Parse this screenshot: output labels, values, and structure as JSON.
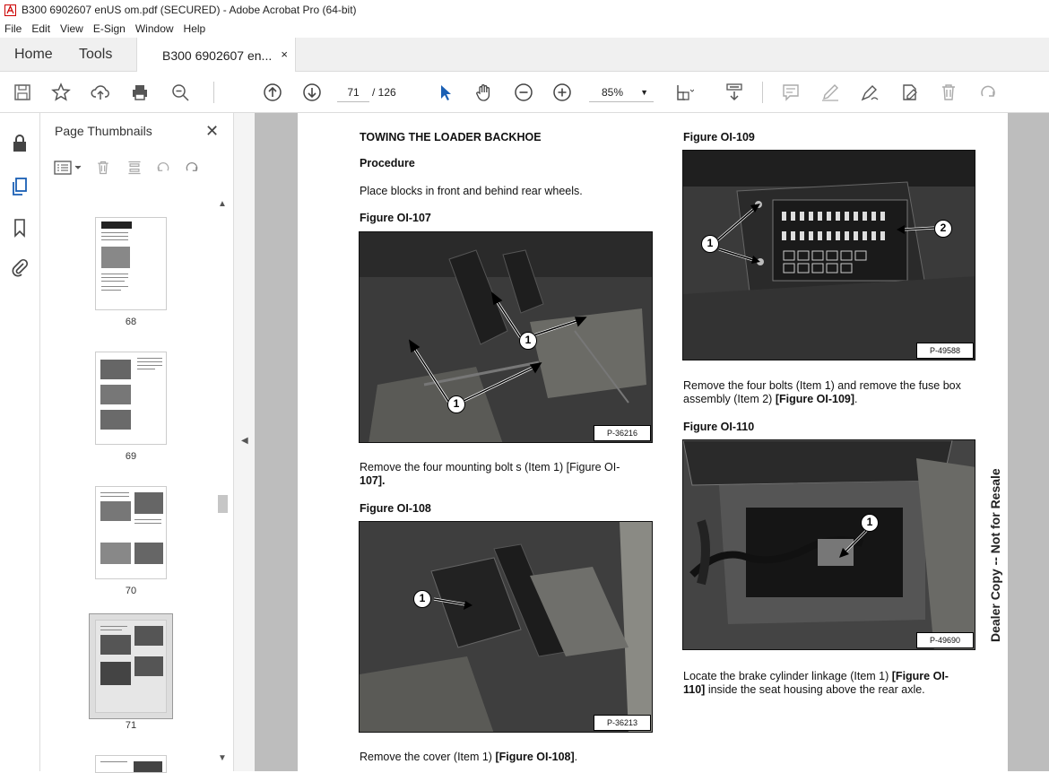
{
  "window": {
    "title": "B300 6902607 enUS om.pdf (SECURED) - Adobe Acrobat Pro (64-bit)"
  },
  "menu": [
    "File",
    "Edit",
    "View",
    "E-Sign",
    "Window",
    "Help"
  ],
  "tabs": {
    "home": "Home",
    "tools": "Tools",
    "document": "B300 6902607 en...",
    "close": "×"
  },
  "toolbar": {
    "page_current": "71",
    "page_total": "/ 126",
    "zoom": "85%"
  },
  "thumbnails": {
    "title": "Page Thumbnails",
    "close": "✕",
    "pages": [
      {
        "label": "68"
      },
      {
        "label": "69"
      },
      {
        "label": "70"
      },
      {
        "label": "71"
      }
    ]
  },
  "page": {
    "heading": "TOWING THE LOADER BACKHOE",
    "procedure": "Procedure",
    "step1": "Place blocks in front and behind rear wheels.",
    "fig107_title": "Figure OI-107",
    "fig107_code": "P-36216",
    "fig107_text_a": "Remove  the four mounting bolt   s  (Item 1)   [Figure  OI-",
    "fig107_text_b": "107].",
    "fig108_title": "Figure OI-108",
    "fig108_code": "P-36213",
    "fig108_text_pre": "Remove the cover (Item 1) ",
    "fig108_text_ref": "[Figure OI-108]",
    "fig108_text_post": ".",
    "fig109_title": "Figure OI-109",
    "fig109_code": "P-49588",
    "fig109_text_a": "Remove the four bolts (Item 1) and remove the fuse box",
    "fig109_text_b_pre": "assembly (Item 2) ",
    "fig109_text_b_ref": "[Figure OI-109]",
    "fig109_text_b_post": ".",
    "fig110_title": "Figure OI-110",
    "fig110_code": "P-49690",
    "fig110_text_a_pre": "Locate  the brake cylinder linkage (Item 1)     ",
    "fig110_text_a_ref": "[Figure  OI-",
    "fig110_text_b_ref": "110]",
    "fig110_text_b_post": " inside the seat housing above the rear axle.",
    "watermark": "Dealer Copy -- Not for Resale",
    "callout_1": "1",
    "callout_2": "2"
  }
}
